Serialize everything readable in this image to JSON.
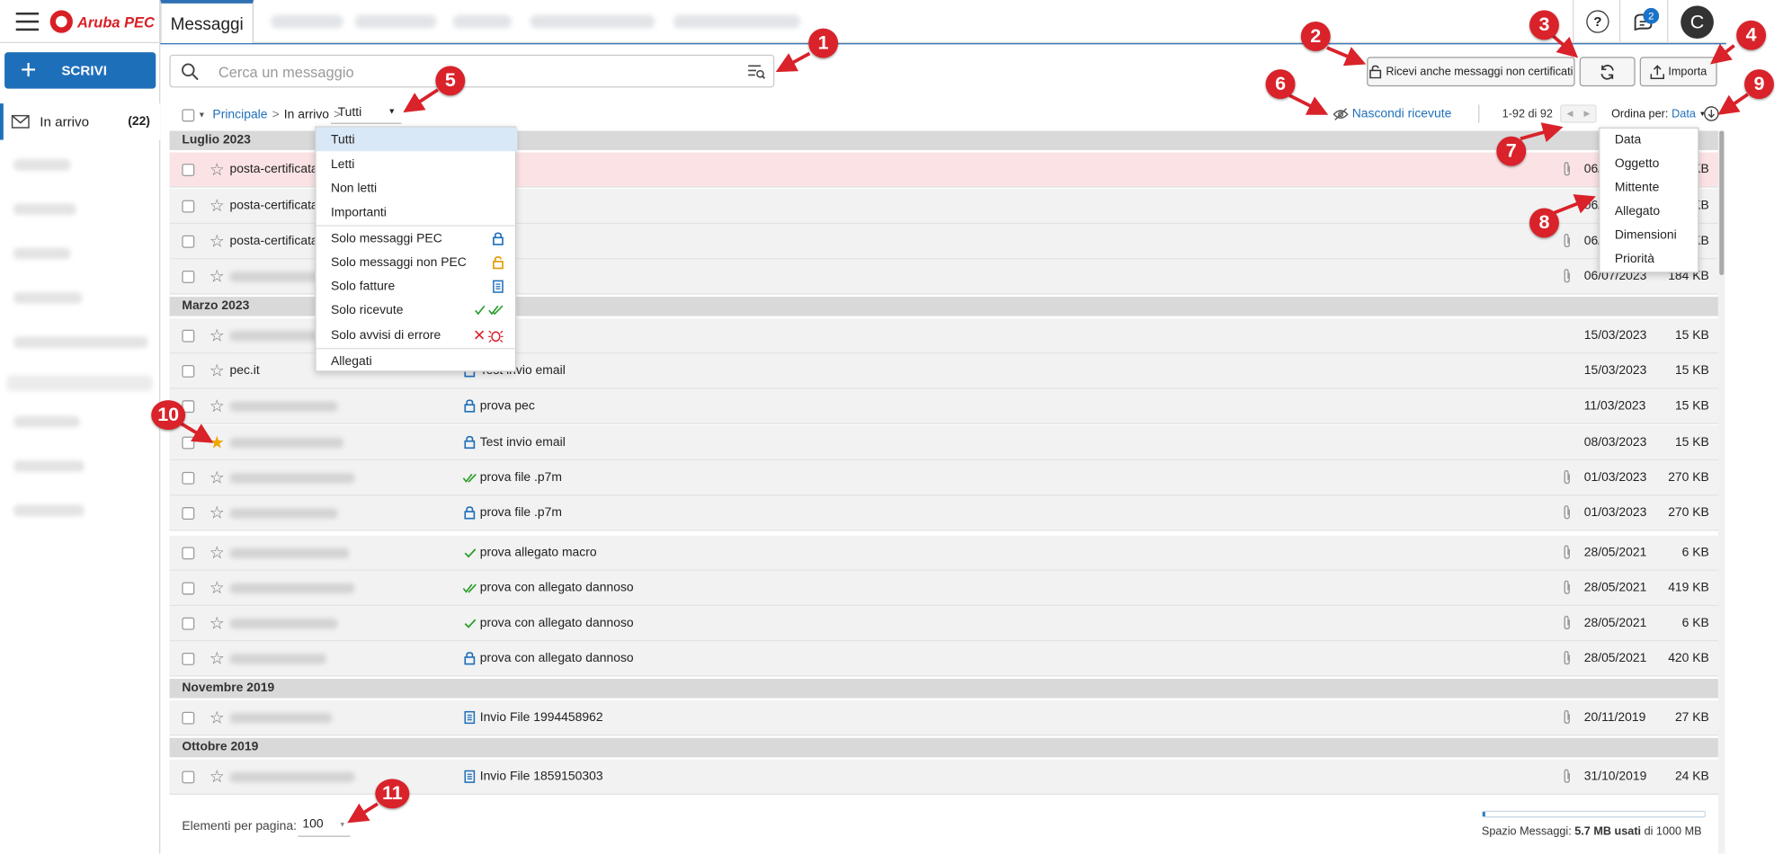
{
  "app": {
    "logo_text": "Aruba PEC",
    "active_tab": "Messaggi",
    "avatar_letter": "C",
    "notifications": "2",
    "help_glyph": "?"
  },
  "sidebar": {
    "write_label": "SCRIVI",
    "write_glyph": "+",
    "inbox": {
      "label": "In arrivo",
      "count": "(22)"
    }
  },
  "toolbar": {
    "search_placeholder": "Cerca un messaggio",
    "receive_label": "Ricevi anche messaggi non certificati",
    "import_label": "Importa"
  },
  "breadcrumb": {
    "root": "Principale",
    "sep": ">",
    "folder": "In arrivo",
    "filter_value": "Tutti",
    "hide_label": "Nascondi ricevute",
    "range": "1-92 di 92",
    "sort_label": "Ordina per:",
    "sort_value": "Data"
  },
  "filter_menu": {
    "items": [
      "Tutti",
      "Letti",
      "Non letti",
      "Importanti",
      "Solo messaggi PEC",
      "Solo messaggi non PEC",
      "Solo fatture",
      "Solo ricevute",
      "Solo avvisi di errore",
      "Allegati"
    ]
  },
  "sort_menu": {
    "items": [
      "Data",
      "Oggetto",
      "Mittente",
      "Allegato",
      "Dimensioni",
      "Priorità"
    ]
  },
  "groups": [
    {
      "label": "Luglio 2023",
      "rows": [
        {
          "from": "posta-certificata@",
          "subject": "email",
          "icon": "",
          "attach": true,
          "date": "06/",
          "size": "KB",
          "starred": false,
          "selected": true
        },
        {
          "from": "posta-certificata@",
          "subject": "email",
          "icon": "",
          "attach": false,
          "date": "06/",
          "size": "KB",
          "starred": false,
          "selected": false
        },
        {
          "from": "posta-certificata@",
          "subject": "email",
          "icon": "",
          "attach": true,
          "date": "06/",
          "size": "KB",
          "starred": false,
          "selected": false
        },
        {
          "from": "",
          "subject": "email",
          "icon": "",
          "attach": true,
          "date": "06/07/2023",
          "size": "184 KB",
          "starred": false,
          "selected": false
        }
      ]
    },
    {
      "label": "Marzo 2023",
      "rows": [
        {
          "from": "",
          "subject": "vio email",
          "icon": "",
          "attach": false,
          "date": "15/03/2023",
          "size": "15 KB",
          "starred": false,
          "selected": false
        },
        {
          "from": "pec.it",
          "subject": "Test invio email",
          "icon": "lock",
          "attach": false,
          "date": "15/03/2023",
          "size": "15 KB",
          "starred": false,
          "selected": false
        },
        {
          "from": "",
          "subject": "prova pec",
          "icon": "lock",
          "attach": false,
          "date": "11/03/2023",
          "size": "15 KB",
          "starred": false,
          "selected": false
        },
        {
          "from": "",
          "subject": "Test invio email",
          "icon": "lock",
          "attach": false,
          "date": "08/03/2023",
          "size": "15 KB",
          "starred": true,
          "selected": false
        },
        {
          "from": "",
          "subject": "prova file .p7m",
          "icon": "double-check",
          "attach": true,
          "date": "01/03/2023",
          "size": "270 KB",
          "starred": false,
          "selected": false
        },
        {
          "from": "",
          "subject": "prova file .p7m",
          "icon": "lock",
          "attach": true,
          "date": "01/03/2023",
          "size": "270 KB",
          "starred": false,
          "selected": false
        },
        {
          "from": "",
          "subject": "prova allegato macro",
          "icon": "check",
          "attach": true,
          "date": "28/05/2021",
          "size": "6 KB",
          "starred": false,
          "selected": false
        },
        {
          "from": "",
          "subject": "prova con allegato dannoso",
          "icon": "double-check",
          "attach": true,
          "date": "28/05/2021",
          "size": "419 KB",
          "starred": false,
          "selected": false
        },
        {
          "from": "",
          "subject": "prova con allegato dannoso",
          "icon": "check",
          "attach": true,
          "date": "28/05/2021",
          "size": "6 KB",
          "starred": false,
          "selected": false
        },
        {
          "from": "",
          "subject": "prova con allegato dannoso",
          "icon": "lock",
          "attach": true,
          "date": "28/05/2021",
          "size": "420 KB",
          "starred": false,
          "selected": false
        }
      ]
    },
    {
      "label": "Novembre 2019",
      "rows": [
        {
          "from": "",
          "subject": "Invio File 1994458962",
          "icon": "invoice",
          "attach": true,
          "date": "20/11/2019",
          "size": "27 KB",
          "starred": false,
          "selected": false
        }
      ]
    },
    {
      "label": "Ottobre 2019",
      "rows": [
        {
          "from": "",
          "subject": "Invio File 1859150303",
          "icon": "invoice",
          "attach": true,
          "date": "31/10/2019",
          "size": "24 KB",
          "starred": false,
          "selected": false
        }
      ]
    }
  ],
  "footer": {
    "per_page_label": "Elementi per pagina:",
    "per_page_value": "100",
    "storage_label": "Spazio Messaggi:",
    "storage_used": "5.7 MB usati",
    "storage_total": "di 1000 MB",
    "storage_fraction": 0.006
  },
  "annotations": [
    "1",
    "2",
    "3",
    "4",
    "5",
    "6",
    "7",
    "8",
    "9",
    "10",
    "11"
  ],
  "colors": {
    "accent": "#1e6fba",
    "annotation": "#d9222a",
    "selected_row": "#fbe3e5"
  }
}
